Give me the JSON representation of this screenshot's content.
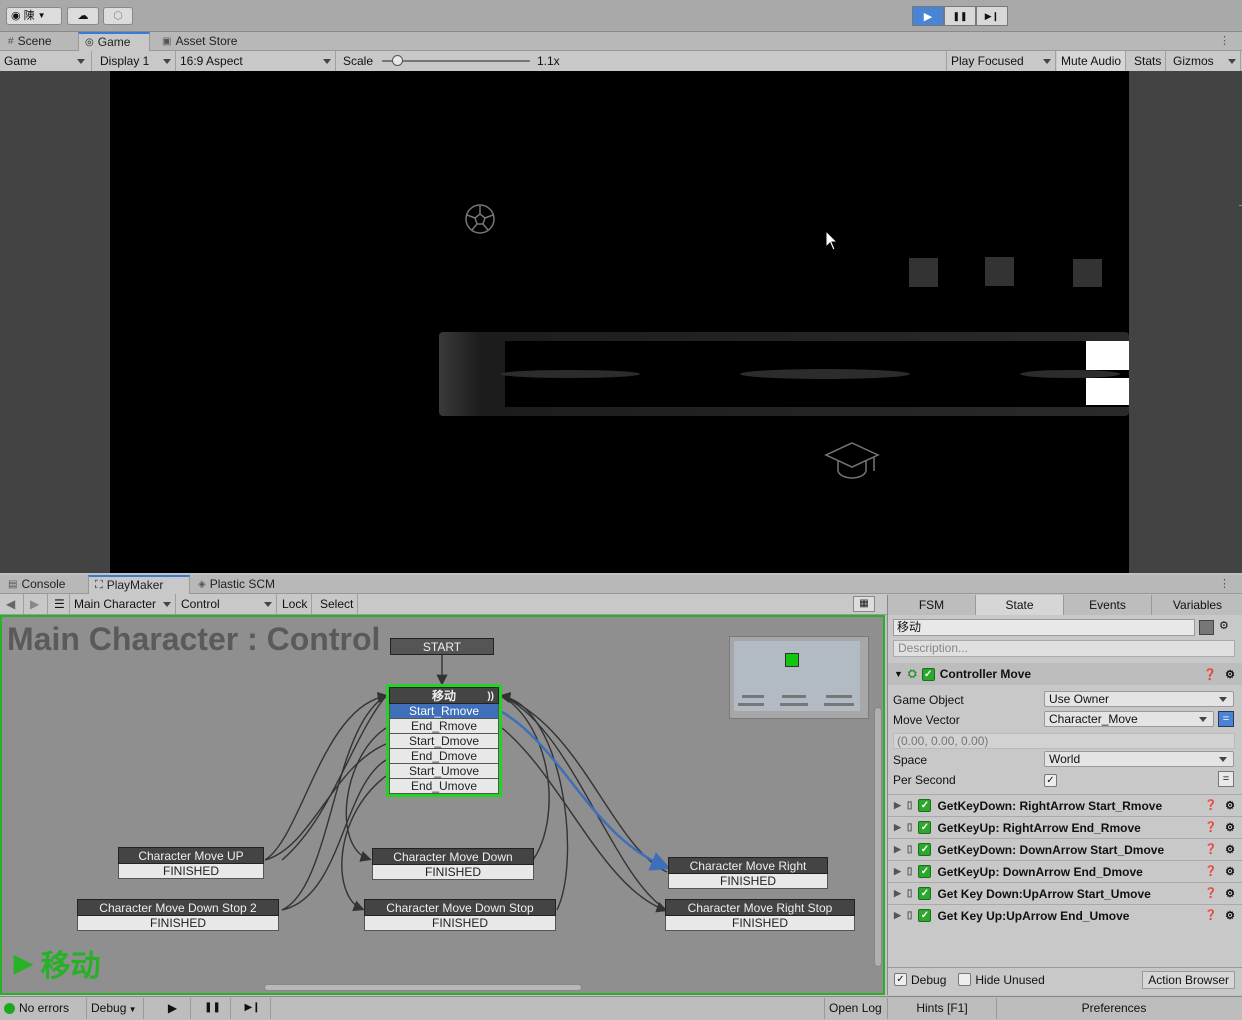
{
  "topbar": {
    "account_label": "陳",
    "cloud_icon": "cloud-icon",
    "collab_icon": "collab-icon",
    "play_icon": "▶",
    "pause_icon": "❚❚",
    "step_icon": "▶❙"
  },
  "game_tabs": {
    "scene": "Scene",
    "game": "Game",
    "asset_store": "Asset Store"
  },
  "game_toolbar": {
    "view": "Game",
    "display": "Display 1",
    "aspect": "16:9 Aspect",
    "scale_label": "Scale",
    "scale_value": "1.1x",
    "scale_fraction": 0.1,
    "play_focused": "Play Focused",
    "mute_audio": "Mute Audio",
    "stats": "Stats",
    "gizmos": "Gizmos"
  },
  "bottom_tabs": {
    "console": "Console",
    "playmaker": "PlayMaker",
    "plastic": "Plastic SCM"
  },
  "fsm_toolbar": {
    "object": "Main Character",
    "fsm": "Control",
    "lock": "Lock",
    "select": "Select"
  },
  "fsm_graph": {
    "title": "Main Character : Control",
    "start_label": "START",
    "active_state_caption": "移动",
    "main_state": {
      "name": "移动",
      "events": [
        "Start_Rmove",
        "End_Rmove",
        "Start_Dmove",
        "End_Dmove",
        "Start_Umove",
        "End_Umove"
      ]
    },
    "states": [
      {
        "name": "Character Move UP",
        "event": "FINISHED"
      },
      {
        "name": "Character Move Down",
        "event": "FINISHED"
      },
      {
        "name": "Character Move Right",
        "event": "FINISHED"
      },
      {
        "name": "Character Move Down Stop 2",
        "event": "FINISHED"
      },
      {
        "name": "Character Move Down Stop",
        "event": "FINISHED"
      },
      {
        "name": "Character Move Right Stop",
        "event": "FINISHED"
      }
    ]
  },
  "inspector": {
    "tabs": [
      "FSM",
      "State",
      "Events",
      "Variables"
    ],
    "state_name": "移动",
    "description_placeholder": "Description...",
    "action_title": "Controller Move",
    "game_object_label": "Game Object",
    "game_object_value": "Use Owner",
    "move_vector_label": "Move Vector",
    "move_vector_value": "Character_Move",
    "vector_readout": "(0.00, 0.00, 0.00)",
    "space_label": "Space",
    "space_value": "World",
    "per_second_label": "Per Second",
    "actions": [
      "GetKeyDown: RightArrow Start_Rmove",
      "GetKeyUp: RightArrow End_Rmove",
      "GetKeyDown: DownArrow Start_Dmove",
      "GetKeyUp: DownArrow End_Dmove",
      "Get Key Down:UpArrow Start_Umove",
      "Get Key Up:UpArrow End_Umove"
    ],
    "debug_label": "Debug",
    "hide_unused_label": "Hide Unused",
    "action_browser": "Action Browser",
    "hints": "Hints [F1]",
    "preferences": "Preferences"
  },
  "status_bar": {
    "errors": "No errors",
    "debug": "Debug",
    "open_log": "Open Log"
  },
  "colors": {
    "accent_blue": "#3a79d6",
    "fsm_green": "#26b126",
    "selected_event": "#3e6fb8"
  }
}
